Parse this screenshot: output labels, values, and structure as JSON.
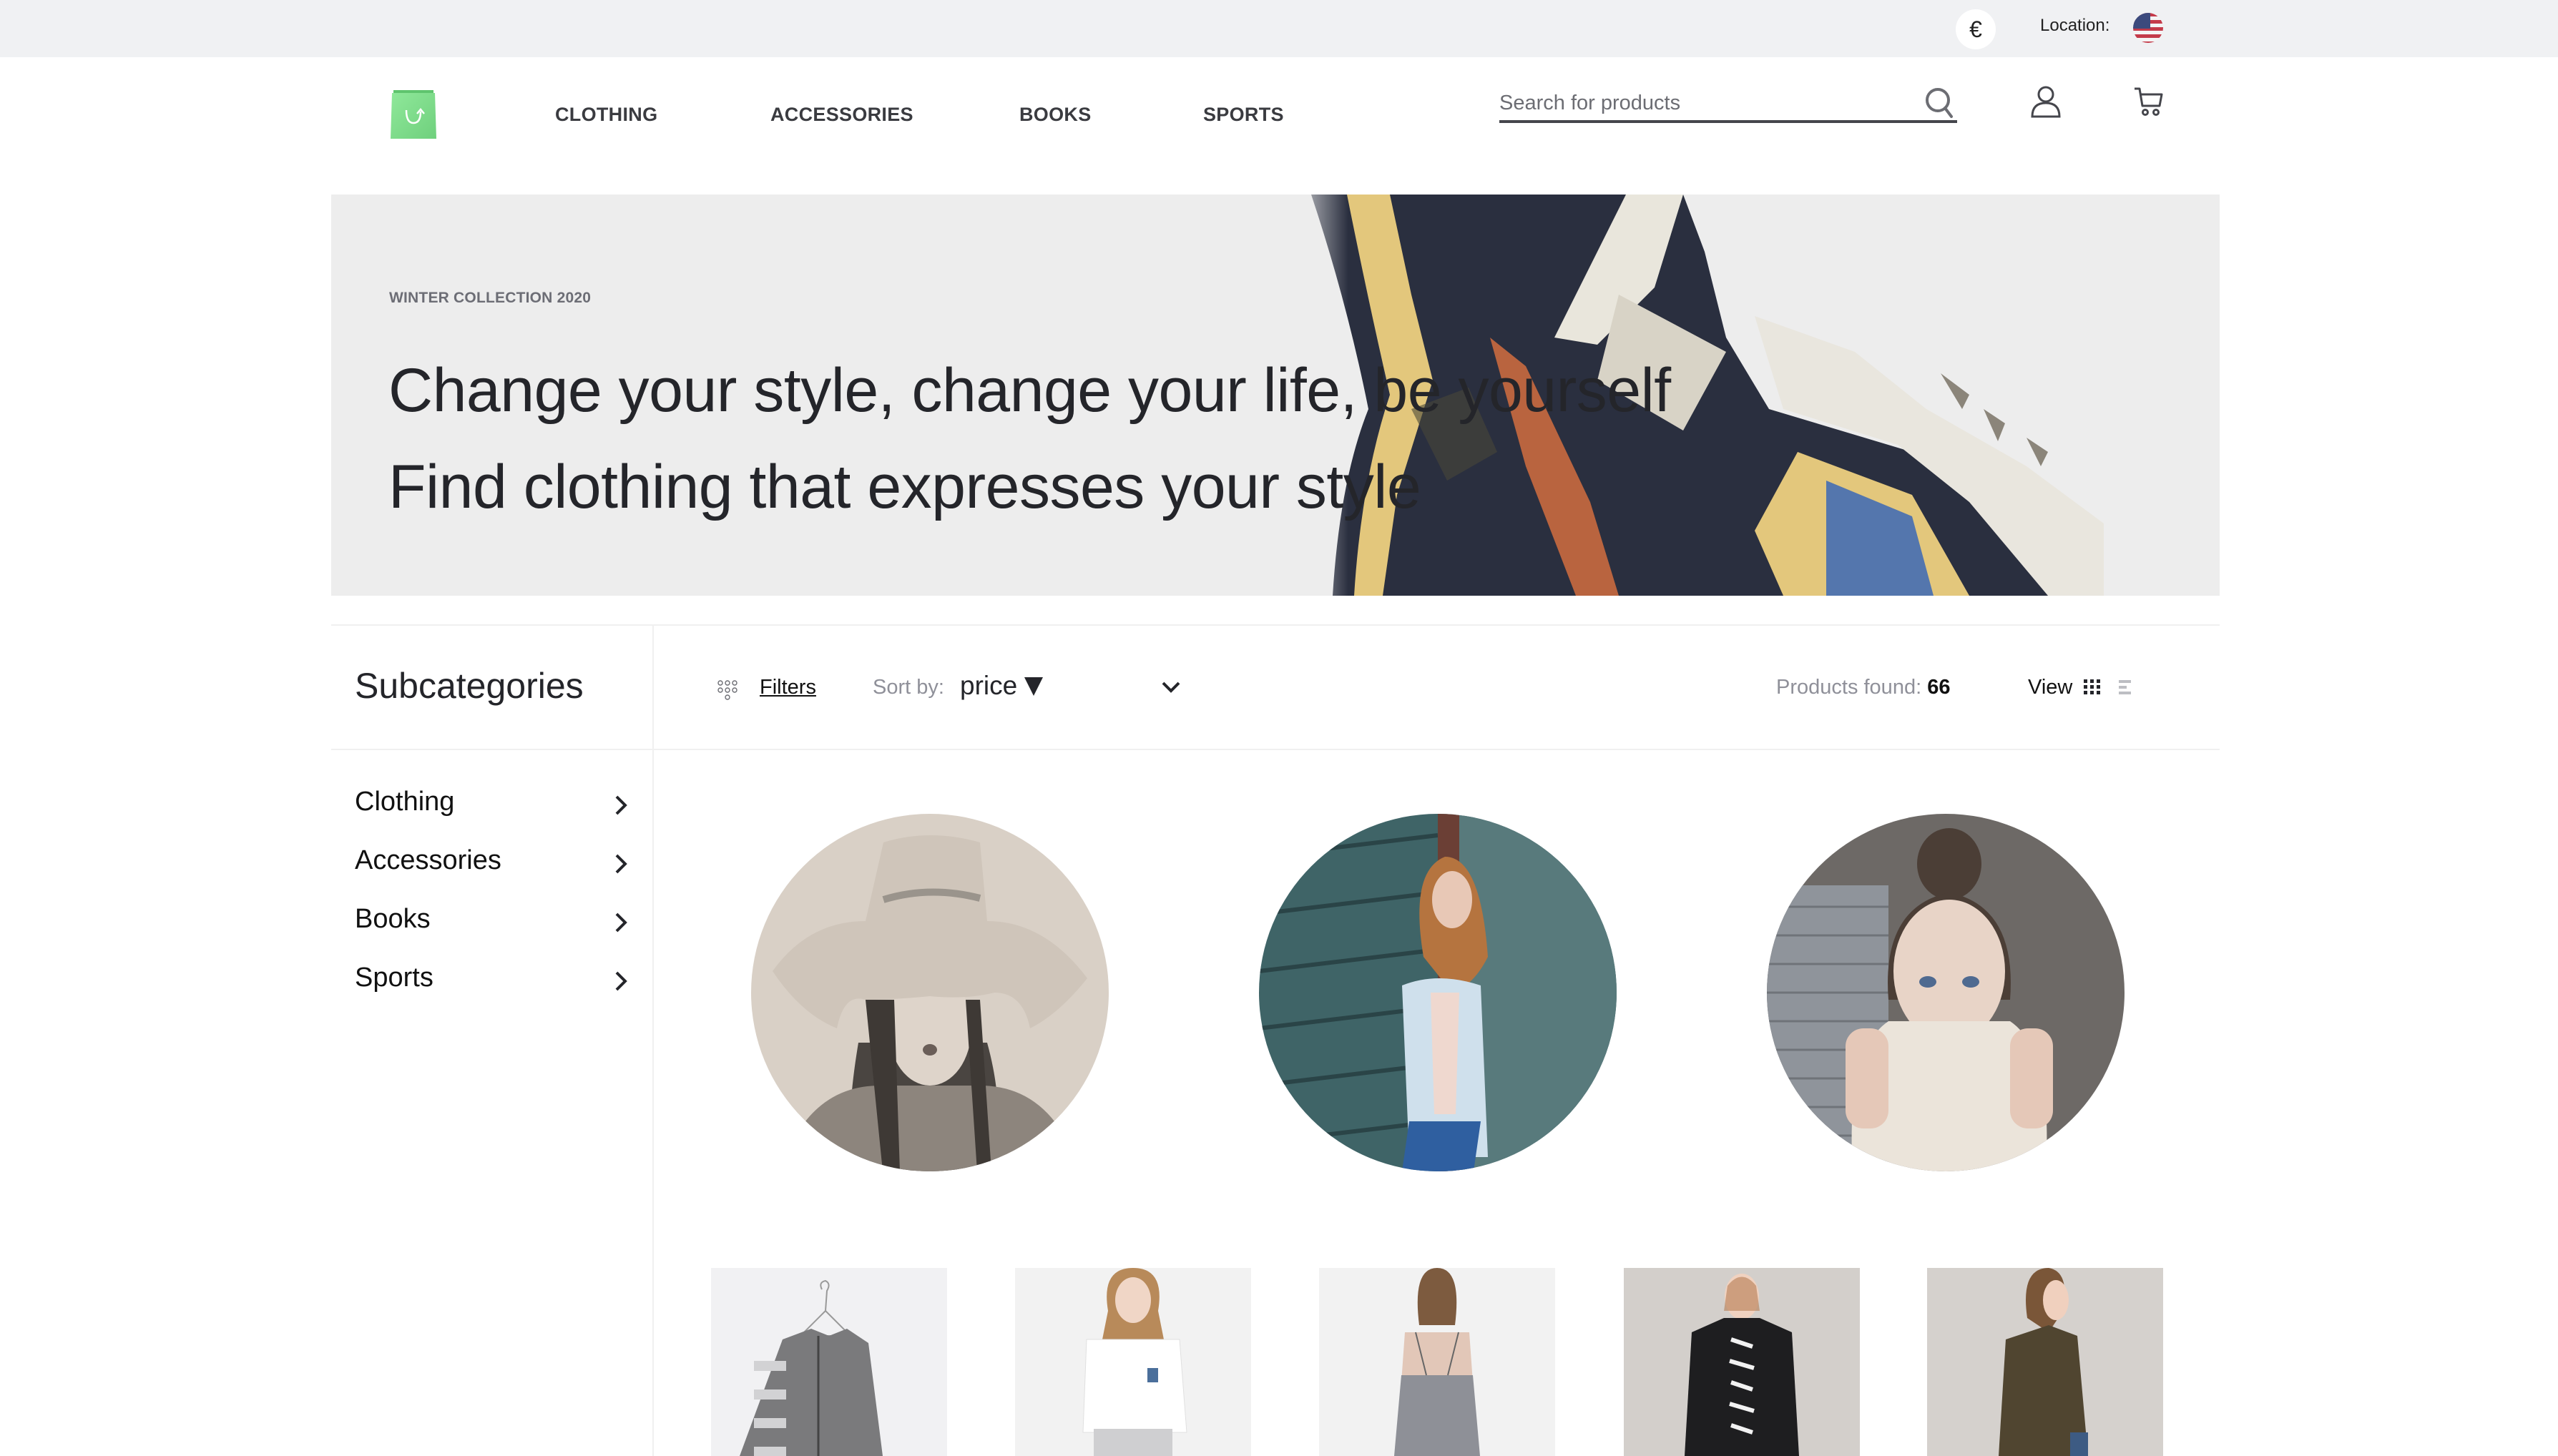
{
  "topbar": {
    "currency_symbol": "€",
    "location_label": "Location:",
    "location_flag": "us-flag-icon"
  },
  "header": {
    "logo": "shopping-bag-logo",
    "nav": [
      {
        "label": "CLOTHING"
      },
      {
        "label": "ACCESSORIES"
      },
      {
        "label": "BOOKS"
      },
      {
        "label": "SPORTS"
      }
    ],
    "search": {
      "placeholder": "Search for products",
      "value": ""
    },
    "icons": [
      "search-icon",
      "user-icon",
      "cart-icon"
    ]
  },
  "hero": {
    "eyebrow": "WINTER COLLECTION 2020",
    "line1": "Change your style, change your life, be yourself",
    "line2": "Find clothing that expresses your style",
    "image": "patterned-scarf-photo"
  },
  "sidebar": {
    "title": "Subcategories",
    "items": [
      {
        "label": "Clothing"
      },
      {
        "label": "Accessories"
      },
      {
        "label": "Books"
      },
      {
        "label": "Sports"
      }
    ]
  },
  "toolbar": {
    "filters_label": "Filters",
    "sort_label": "Sort by:",
    "sort_value": "price",
    "sort_direction": "descending",
    "products_found_label": "Products found:",
    "products_found_count": "66",
    "view_label": "View",
    "view_mode": "grid"
  },
  "featured": [
    {
      "image": "woman-in-wide-brim-hat-photo"
    },
    {
      "image": "woman-in-denim-jacket-photo"
    },
    {
      "image": "woman-in-knit-sweater-photo"
    }
  ],
  "products": [
    {
      "image": "striped-knit-cardigan-on-hanger"
    },
    {
      "image": "model-white-tshirt"
    },
    {
      "image": "model-grey-lace-dress"
    },
    {
      "image": "model-black-coat-striped-top"
    },
    {
      "image": "model-olive-jacket"
    }
  ],
  "colors": {
    "accent_green": "#7ddc8a",
    "topbar_bg": "#f0f1f3",
    "hero_bg": "#ededed",
    "text_dark": "#24252a",
    "text_muted": "#8f9099"
  }
}
